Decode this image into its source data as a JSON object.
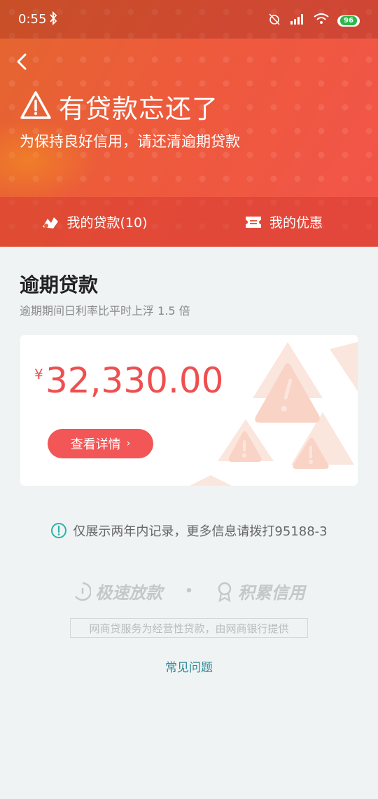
{
  "status_bar": {
    "time": "0:55",
    "battery": "96"
  },
  "header": {
    "title": "有贷款忘还了",
    "subtitle": "为保持良好信用，请还清逾期贷款",
    "tabs": [
      {
        "label": "我的贷款(10)",
        "icon": "loan-icon"
      },
      {
        "label": "我的优惠",
        "icon": "ticket-icon"
      }
    ]
  },
  "section": {
    "title": "逾期贷款",
    "subtitle": "逾期期间日利率比平时上浮 1.5 倍"
  },
  "card": {
    "currency": "¥",
    "amount": "32,330.00",
    "button_label": "查看详情",
    "button_chevron": "›"
  },
  "notice": {
    "text": "仅展示两年内记录，更多信息请拨打95188-3",
    "icon": "info-icon"
  },
  "features": [
    {
      "label": "极速放款",
      "icon": "timer-icon"
    },
    {
      "label": "积累信用",
      "icon": "medal-icon"
    }
  ],
  "features_separator": "•",
  "disclaimer": "网商贷服务为经营性贷款，由网商银行提供",
  "faq_link": "常见问题",
  "colors": {
    "accent": "#f25656",
    "link": "#2d8a98",
    "hero": "#ee5a3c"
  }
}
